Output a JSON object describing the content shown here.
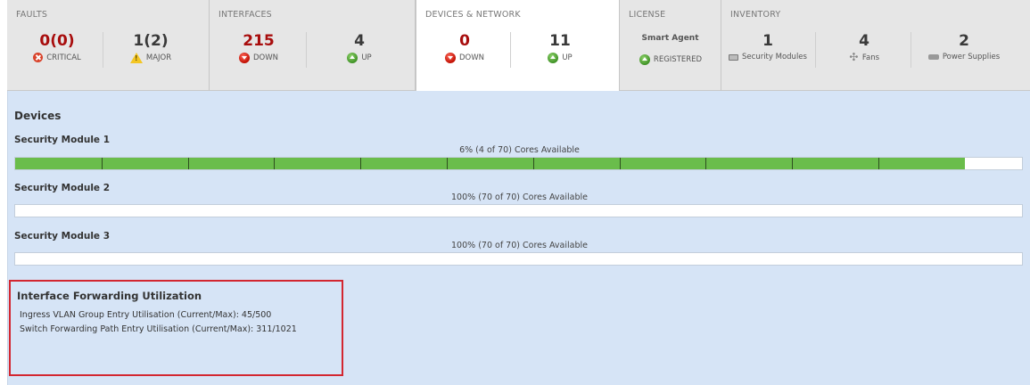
{
  "faults": {
    "title": "FAULTS",
    "critical": {
      "value": "0(0)",
      "label": "CRITICAL",
      "icon": "critical-icon"
    },
    "major": {
      "value": "1(2)",
      "label": "MAJOR",
      "icon": "warning-icon"
    }
  },
  "interfaces": {
    "title": "INTERFACES",
    "down": {
      "value": "215",
      "label": "DOWN"
    },
    "up": {
      "value": "4",
      "label": "UP"
    }
  },
  "devices_network": {
    "title": "DEVICES & NETWORK",
    "down": {
      "value": "0",
      "label": "DOWN"
    },
    "up": {
      "value": "11",
      "label": "UP"
    }
  },
  "license": {
    "title": "LICENSE",
    "type": "Smart Agent",
    "status": "REGISTERED"
  },
  "inventory": {
    "title": "INVENTORY",
    "modules": {
      "value": "1",
      "label": "Security Modules"
    },
    "fans": {
      "value": "4",
      "label": "Fans"
    },
    "power": {
      "value": "2",
      "label": "Power Supplies"
    }
  },
  "devices": {
    "title": "Devices",
    "modules": [
      {
        "name": "Security Module 1",
        "cores_text": "6% (4 of 70) Cores Available",
        "used_fraction": 0.943,
        "segments": 11
      },
      {
        "name": "Security Module 2",
        "cores_text": "100% (70 of 70) Cores Available",
        "used_fraction": 0,
        "segments": 0
      },
      {
        "name": "Security Module 3",
        "cores_text": "100% (70 of 70) Cores Available",
        "used_fraction": 0,
        "segments": 0
      }
    ]
  },
  "ifu": {
    "title": "Interface Forwarding Utilization",
    "ingress": "Ingress VLAN Group Entry Utilisation (Current/Max): 45/500",
    "switch": "Switch Forwarding Path Entry Utilisation (Current/Max): 311/1021"
  },
  "colors": {
    "critical_red": "#a80d0d",
    "bar_green": "#6abd4b",
    "highlight_border": "#d32630",
    "content_bg": "#d6e4f6"
  }
}
